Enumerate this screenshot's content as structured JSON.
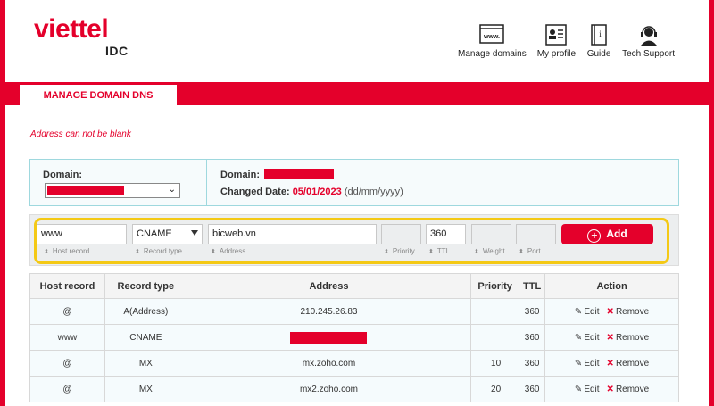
{
  "brand": {
    "name": "viettel",
    "sub": "IDC"
  },
  "topnav": [
    {
      "label": "Manage domains",
      "icon": "www-icon"
    },
    {
      "label": "My profile",
      "icon": "profile-card-icon"
    },
    {
      "label": "Guide",
      "icon": "guide-book-icon"
    },
    {
      "label": "Tech Support",
      "icon": "headset-icon"
    }
  ],
  "tab": "MANAGE DOMAIN DNS",
  "error": "Address can not be blank",
  "domain": {
    "label": "Domain:",
    "info_label": "Domain:",
    "changed_label": "Changed Date:",
    "changed_value": "05/01/2023",
    "changed_format": "(dd/mm/yyyy)"
  },
  "form": {
    "host": "www",
    "host_label": "Host record",
    "type": "CNAME",
    "type_label": "Record type",
    "address": "bicweb.vn",
    "address_label": "Address",
    "priority": "",
    "priority_label": "Priority",
    "ttl": "360",
    "ttl_label": "TTL",
    "weight": "",
    "weight_label": "Weight",
    "port": "",
    "port_label": "Port",
    "add": "Add"
  },
  "table": {
    "headers": [
      "Host record",
      "Record type",
      "Address",
      "Priority",
      "TTL",
      "Action"
    ],
    "rows": [
      {
        "host": "@",
        "type": "A(Address)",
        "address": "210.245.26.83",
        "priority": "",
        "ttl": "360"
      },
      {
        "host": "www",
        "type": "CNAME",
        "address": "",
        "priority": "",
        "ttl": "360"
      },
      {
        "host": "@",
        "type": "MX",
        "address": "mx.zoho.com",
        "priority": "10",
        "ttl": "360"
      },
      {
        "host": "@",
        "type": "MX",
        "address": "mx2.zoho.com",
        "priority": "20",
        "ttl": "360"
      }
    ],
    "edit": "Edit",
    "remove": "Remove"
  },
  "colors": {
    "accent": "#e4002b",
    "highlight": "#f4c915"
  }
}
